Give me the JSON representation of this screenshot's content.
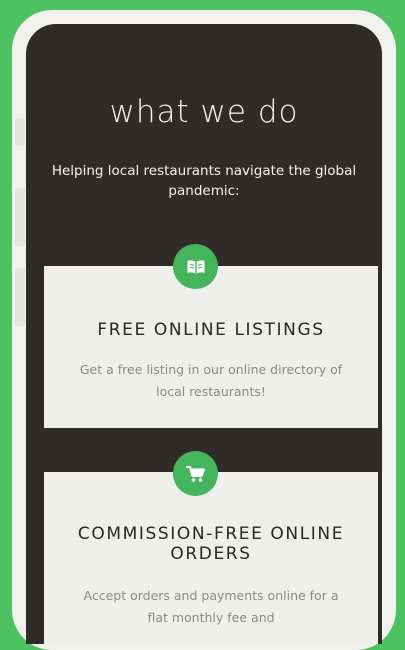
{
  "section": {
    "title": "what we do",
    "subtitle": "Helping local restaurants navigate the global pandemic:"
  },
  "cards": [
    {
      "icon": "book-icon",
      "title": "FREE ONLINE LISTINGS",
      "text": "Get a free listing in our online directory of local restaurants!"
    },
    {
      "icon": "cart-icon",
      "title": "COMMISSION-FREE ONLINE ORDERS",
      "text": "Accept orders and payments online for a flat monthly fee and"
    }
  ],
  "colors": {
    "page_background": "#4ec160",
    "screen_background": "#2e2b28",
    "card_background": "#efefed",
    "accent": "#45b55b"
  }
}
